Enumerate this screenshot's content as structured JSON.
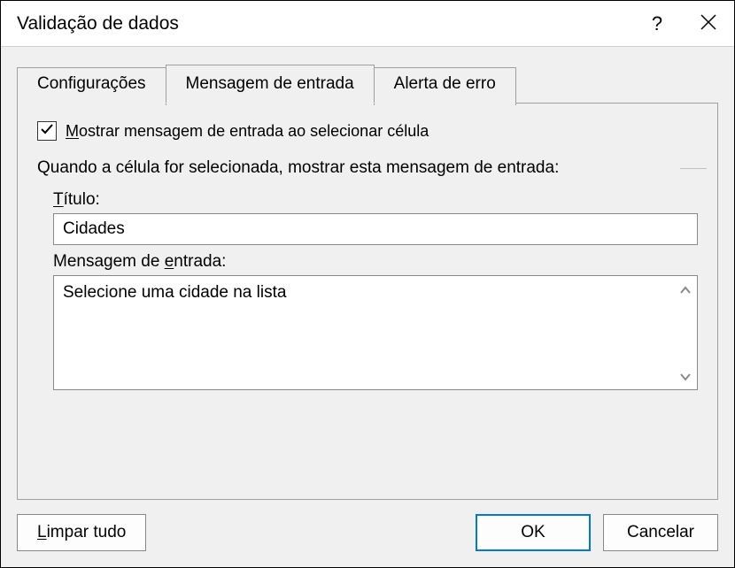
{
  "titlebar": {
    "title": "Validação de dados"
  },
  "tabs": {
    "settings": "Configurações",
    "input_message": "Mensagem de entrada",
    "error_alert": "Alerta de erro"
  },
  "panel": {
    "checkbox_label_pre": "M",
    "checkbox_label_rest": "ostrar mensagem de entrada ao selecionar célula",
    "fieldset_text": "Quando a célula for selecionada, mostrar esta mensagem de entrada:",
    "title_label_pre": "T",
    "title_label_rest": "ítulo:",
    "title_value": "Cidades",
    "message_label_pre": "Mensagem de ",
    "message_label_u": "e",
    "message_label_post": "ntrada:",
    "message_value": "Selecione uma cidade na lista"
  },
  "buttons": {
    "clear_pre": "L",
    "clear_rest": "impar tudo",
    "ok": "OK",
    "cancel": "Cancelar"
  }
}
